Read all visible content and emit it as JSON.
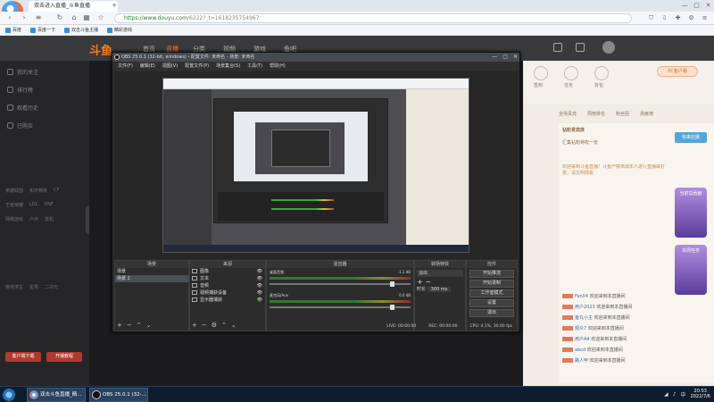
{
  "browser": {
    "tab_title": "双击进入直播_斗鱼直播",
    "new_tab": "+",
    "url_secure": "https://www.douyu.com",
    "url_rest": "/6222?_t=1618235754967",
    "controls": [
      "—",
      "▢",
      "✕"
    ],
    "bookmarks": [
      "百度",
      "百度一下",
      "双击斗鱼主播",
      "精彩游戏"
    ]
  },
  "douyu": {
    "logo": "斗鱼",
    "nav": [
      "首页",
      "直播",
      "分类",
      "视频",
      "游戏",
      "鱼吧"
    ],
    "side_items": [
      "我的关注",
      "排行榜",
      "观看历史",
      "已购买"
    ],
    "side_grid": [
      [
        "英雄联盟",
        "和平精英",
        "CF"
      ],
      [
        "王者荣耀",
        "LOL",
        "DNF"
      ],
      [
        "网络游戏",
        "户外",
        "单机"
      ],
      [
        "绝地求生",
        "星秀",
        "二次元"
      ]
    ],
    "side_buttons": [
      "客户端下载",
      "开播教程"
    ],
    "right_icons": [
      "签到",
      "任务",
      "背包"
    ],
    "pc_button": "PC客户端",
    "chat_tabs": [
      "全场贵宾",
      "周榜排名",
      "粉丝团",
      "贡献榜"
    ],
    "fans_label": "钻粉贵宾席",
    "fans_line": "汇集钻粉特权一览",
    "system_msg": "欢迎来到斗鱼直播！斗鱼严禁未成年人进行直播或打赏，请文明观看",
    "chat": [
      {
        "nick": "Fan04",
        "text": "欢迎来到本直播间"
      },
      {
        "nick": "用户2023",
        "text": "欢迎来到本直播间"
      },
      {
        "nick": "鱼丸小主",
        "text": "欢迎来到本直播间"
      },
      {
        "nick": "观众7",
        "text": "欢迎来到本直播间"
      },
      {
        "nick": "用户A4",
        "text": "欢迎来到本直播间"
      },
      {
        "nick": "abcd",
        "text": "欢迎来到本直播间"
      },
      {
        "nick": "路人甲",
        "text": "欢迎来到本直播间"
      }
    ],
    "promo_top": "快来应援",
    "promos": [
      "当前总贡献",
      "本周任务"
    ]
  },
  "obs": {
    "title": "OBS 25.0.1 (32-bit, windows) - 配置文件: 未命名 - 场景: 未命名",
    "menu": [
      "文件(F)",
      "编辑(E)",
      "视图(V)",
      "配置文件(P)",
      "场景集合(S)",
      "工具(T)",
      "帮助(H)"
    ],
    "docks": {
      "scenes": "场景",
      "sources": "来源",
      "mixer": "混音器",
      "transitions": "转场特效",
      "controls": "控件"
    },
    "scene_list": [
      "场景",
      "场景 2"
    ],
    "source_list": [
      "图像",
      "文本",
      "音频",
      "视频捕获设备",
      "显示器捕获"
    ],
    "mixer_channels": [
      {
        "name": "桌面音频",
        "db": "-1.1 dB"
      },
      {
        "name": "麦克风/Aux",
        "db": "0.0 dB"
      }
    ],
    "transition": "淡出",
    "duration_label": "时长",
    "duration": "300 ms",
    "control_buttons": [
      "开始推流",
      "开始录制",
      "工作室模式",
      "设置",
      "退出"
    ],
    "status": [
      "LIVE: 00:00:00",
      "REC: 00:00:00",
      "CPU: 4.1%, 30.00 fps"
    ],
    "foot_glyphs": [
      "+",
      "−",
      "⌃",
      "⌄"
    ]
  },
  "taskbar": {
    "items": [
      "双击斗鱼直播_精...",
      "OBS 25.0.1 (32-..."
    ],
    "time": "20:53",
    "date": "2022/7/6"
  },
  "colors": {
    "douyu_orange": "#ff7a1a",
    "obs_bg": "#2b2b2b",
    "taskbar": "#0d1c2f"
  }
}
